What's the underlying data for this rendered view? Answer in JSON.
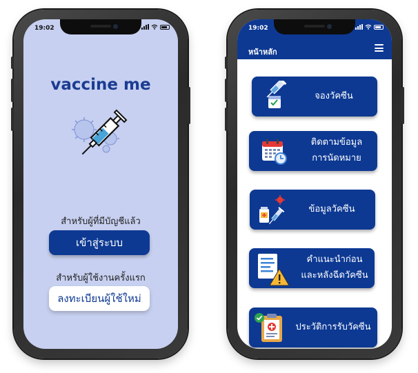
{
  "login_screen": {
    "status_time": "19:02",
    "brand": "vaccine me",
    "existing_account_caption": "สำหรับผู้ที่มีบัญชีแล้ว",
    "login_button": "เข้าสู่ระบบ",
    "new_user_caption": "สำหรับผู้ใช้งานครั้งแรก",
    "register_button": "ลงทะเบียนผู้ใช้ใหม่"
  },
  "home_screen": {
    "status_time": "19:02",
    "title": "หน้าหลัก",
    "menu": [
      {
        "label": "จองวัคซีน",
        "icon": "syringe-vial-icon"
      },
      {
        "label_line1": "ติดตามข้อมูล",
        "label_line2": "การนัดหมาย",
        "icon": "calendar-clock-icon"
      },
      {
        "label": "ข้อมูลวัคซีน",
        "icon": "vaccine-bottle-icon"
      },
      {
        "label_line1": "คำแนะนำก่อน",
        "label_line2": "และหลังฉีดวัคซีน",
        "icon": "document-warning-icon"
      },
      {
        "label": "ประวัติการรับวัคซีน",
        "icon": "medical-record-icon"
      }
    ]
  },
  "colors": {
    "primary": "#0d3993",
    "login_background": "#c7d0f0",
    "brand_text": "#1b3c91"
  }
}
